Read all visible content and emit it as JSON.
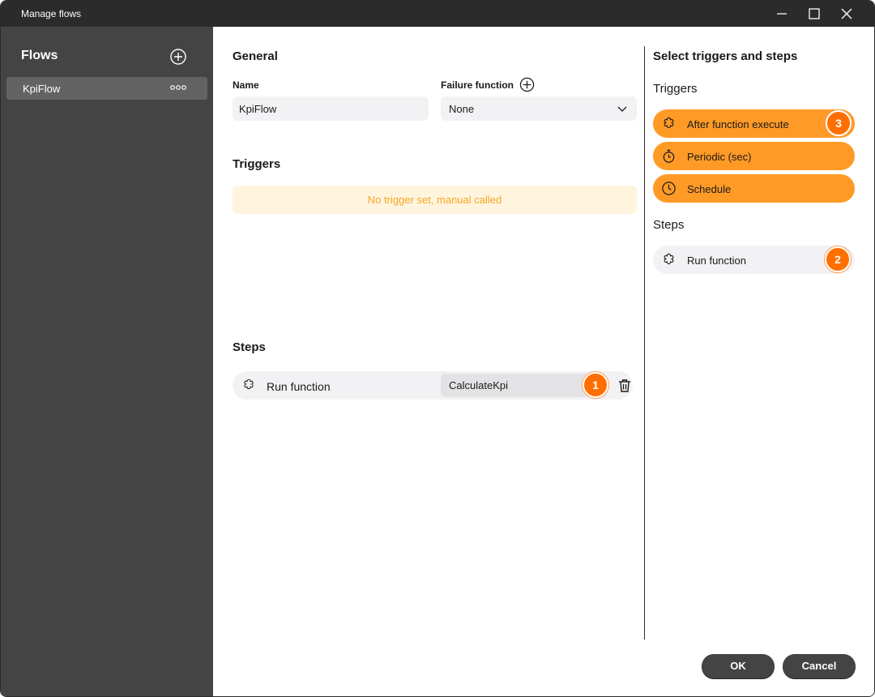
{
  "window": {
    "title": "Manage flows"
  },
  "sidebar": {
    "heading": "Flows",
    "items": [
      {
        "label": "KpiFlow"
      }
    ]
  },
  "general": {
    "heading": "General",
    "name_label": "Name",
    "name_value": "KpiFlow",
    "failure_label": "Failure function",
    "failure_value": "None"
  },
  "triggers": {
    "heading": "Triggers",
    "empty_text": "No trigger set, manual called"
  },
  "steps": {
    "heading": "Steps",
    "items": [
      {
        "label": "Run function",
        "value": "CalculateKpi",
        "badge": "1"
      }
    ]
  },
  "picker": {
    "heading": "Select triggers and steps",
    "triggers_heading": "Triggers",
    "triggers": [
      {
        "label": "After function execute",
        "icon": "function-icon",
        "badge": "3"
      },
      {
        "label": "Periodic (sec)",
        "icon": "stopwatch-icon"
      },
      {
        "label": "Schedule",
        "icon": "clock-icon"
      }
    ],
    "steps_heading": "Steps",
    "steps": [
      {
        "label": "Run function",
        "icon": "function-icon",
        "badge": "2"
      }
    ]
  },
  "footer": {
    "ok_label": "OK",
    "cancel_label": "Cancel"
  },
  "colors": {
    "accent_orange": "#ff9a26",
    "badge_orange": "#ff6f00",
    "sidebar_bg": "#444444",
    "titlebar_bg": "#2b2b2b",
    "notice_text": "#f5a623"
  }
}
